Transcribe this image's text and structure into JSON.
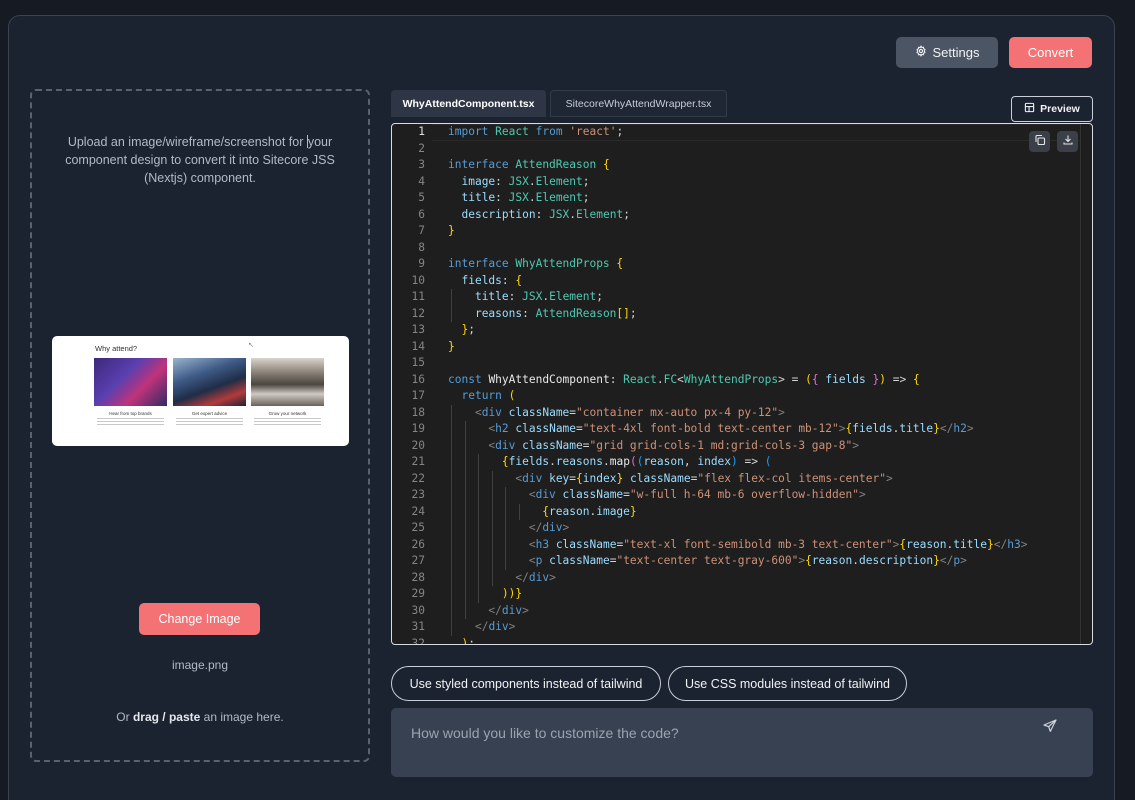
{
  "toolbar": {
    "settings_label": "Settings",
    "convert_label": "Convert"
  },
  "upload": {
    "instructions_before_cursor": "Upload an image/wireframe/screenshot for ",
    "instructions_after_cursor": "your component design to convert it into Sitecore JSS (Nextjs) component.",
    "change_image_label": "Change Image",
    "file_name": "image.png",
    "drag_prefix": "Or ",
    "drag_bold": "drag / paste",
    "drag_suffix": " an image here.",
    "preview": {
      "heading": "Why attend?",
      "captions": [
        "Hear from top brands",
        "Get expert advice",
        "Grow your network"
      ]
    }
  },
  "tabs": [
    {
      "label": "WhyAttendComponent.tsx",
      "active": true
    },
    {
      "label": "SitecoreWhyAttendWrapper.tsx",
      "active": false
    }
  ],
  "preview_button_label": "Preview",
  "editor": {
    "active_line": 1,
    "lines": [
      "import React from 'react';",
      "",
      "interface AttendReason {",
      "  image: JSX.Element;",
      "  title: JSX.Element;",
      "  description: JSX.Element;",
      "}",
      "",
      "interface WhyAttendProps {",
      "  fields: {",
      "    title: JSX.Element;",
      "    reasons: AttendReason[];",
      "  };",
      "}",
      "",
      "const WhyAttendComponent: React.FC<WhyAttendProps> = ({ fields }) => {",
      "  return (",
      "    <div className=\"container mx-auto px-4 py-12\">",
      "      <h2 className=\"text-4xl font-bold text-center mb-12\">{fields.title}</h2>",
      "      <div className=\"grid grid-cols-1 md:grid-cols-3 gap-8\">",
      "        {fields.reasons.map((reason, index) => (",
      "          <div key={index} className=\"flex flex-col items-center\">",
      "            <div className=\"w-full h-64 mb-6 overflow-hidden\">",
      "              {reason.image}",
      "            </div>",
      "            <h3 className=\"text-xl font-semibold mb-3 text-center\">{reason.title}</h3>",
      "            <p className=\"text-center text-gray-600\">{reason.description}</p>",
      "          </div>",
      "        ))}",
      "      </div>",
      "    </div>",
      "  );"
    ]
  },
  "suggestions": [
    "Use styled components instead of tailwind",
    "Use CSS modules instead of tailwind"
  ],
  "prompt": {
    "placeholder": "How would you like to customize the code?",
    "value": ""
  },
  "icons": {
    "settings": "gear-icon",
    "preview": "layout-icon",
    "copy": "copy-icon",
    "download": "download-icon",
    "send": "send-icon"
  }
}
